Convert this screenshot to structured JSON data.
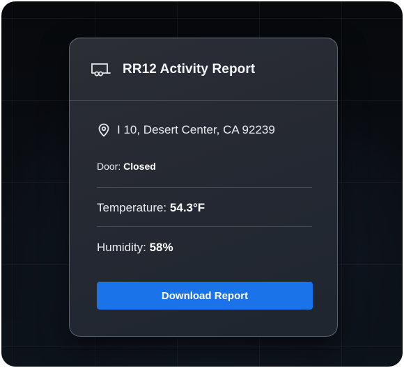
{
  "card": {
    "title": "RR12 Activity Report",
    "header_icon": "trailer-icon",
    "location_icon": "map-pin-icon",
    "location": "I 10, Desert Center, CA 92239",
    "door": {
      "label": "Door:",
      "value": "Closed"
    },
    "temperature": {
      "label": "Temperature:",
      "value": "54.3°F"
    },
    "humidity": {
      "label": "Humidity:",
      "value": "58%"
    },
    "download_label": "Download Report"
  },
  "colors": {
    "accent": "#1a73e8",
    "card_background": "#262a32",
    "page_background": "#07090c"
  }
}
